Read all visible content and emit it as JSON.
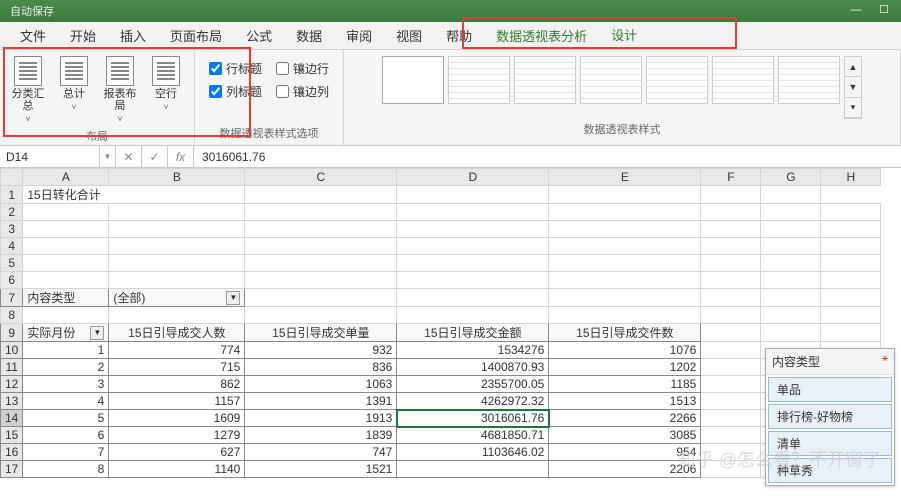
{
  "titlebar": {
    "autoSave": "自动保存"
  },
  "menu": {
    "tabs": [
      "文件",
      "开始",
      "插入",
      "页面布局",
      "公式",
      "数据",
      "审阅",
      "视图",
      "帮助",
      "数据透视表分析",
      "设计"
    ],
    "activeIndex": 10
  },
  "ribbon": {
    "layoutGroup": {
      "label": "布局",
      "btns": [
        {
          "label": "分类汇总",
          "drop": "˅"
        },
        {
          "label": "总计",
          "drop": "˅"
        },
        {
          "label": "报表布局",
          "drop": "˅"
        },
        {
          "label": "空行",
          "drop": "˅"
        }
      ]
    },
    "styleOptions": {
      "label": "数据透视表样式选项",
      "checks": [
        {
          "label": "行标题",
          "checked": true
        },
        {
          "label": "镶边行",
          "checked": false
        },
        {
          "label": "列标题",
          "checked": true
        },
        {
          "label": "镶边列",
          "checked": false
        }
      ]
    },
    "stylesLabel": "数据透视表样式"
  },
  "namebox": "D14",
  "formula": "3016061.76",
  "columns": [
    "",
    "A",
    "B",
    "C",
    "D",
    "E",
    "F",
    "G",
    "H"
  ],
  "a1": "15日转化合计",
  "filterLabel": "内容类型",
  "filterValue": "(全部)",
  "pivotHeaders": [
    "实际月份",
    "15日引导成交人数",
    "15日引导成交单量",
    "15日引导成交金额",
    "15日引导成交件数"
  ],
  "pivotRows": [
    {
      "m": "1",
      "a": "774",
      "b": "932",
      "c": "1534276",
      "d": "1076"
    },
    {
      "m": "2",
      "a": "715",
      "b": "836",
      "c": "1400870.93",
      "d": "1202"
    },
    {
      "m": "3",
      "a": "862",
      "b": "1063",
      "c": "2355700.05",
      "d": "1185"
    },
    {
      "m": "4",
      "a": "1157",
      "b": "1391",
      "c": "4262972.32",
      "d": "1513"
    },
    {
      "m": "5",
      "a": "1609",
      "b": "1913",
      "c": "3016061.76",
      "d": "2266"
    },
    {
      "m": "6",
      "a": "1279",
      "b": "1839",
      "c": "4681850.71",
      "d": "3085"
    },
    {
      "m": "7",
      "a": "627",
      "b": "747",
      "c": "1103646.02",
      "d": "954"
    },
    {
      "m": "8",
      "a": "1140",
      "b": "1521",
      "c": "",
      "d": "2206"
    }
  ],
  "slicer": {
    "title": "内容类型",
    "items": [
      "单品",
      "排行榜-好物榜",
      "清单",
      "种草秀"
    ]
  },
  "watermark": "知乎 @怎么看？不开窗了"
}
